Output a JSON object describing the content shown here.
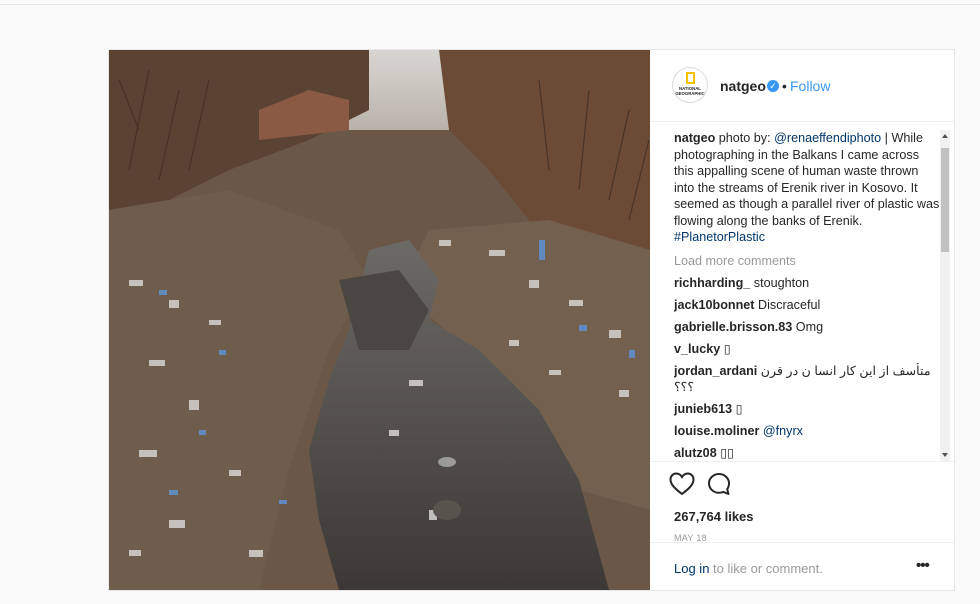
{
  "header": {
    "avatar_text": "NATIONAL GEOGRAPHIC",
    "username": "natgeo",
    "dot": "•",
    "follow_label": "Follow"
  },
  "caption": {
    "username": "natgeo",
    "text_before": " photo by: ",
    "mention": "@renaeffendiphoto",
    "text_after": " | While photographing in the Balkans I came across this appalling scene of human waste thrown into the streams of Erenik river in Kosovo. It seemed as though a parallel river of plastic was flowing along the banks of Erenik. ",
    "hashtag": "#PlanetorPlastic"
  },
  "load_more_label": "Load more comments",
  "comments": [
    {
      "user": "richharding_",
      "text": "stoughton"
    },
    {
      "user": "jack10bonnet",
      "text": "Discraceful"
    },
    {
      "user": "gabrielle.brisson.83",
      "text": "Omg"
    },
    {
      "user": "v_lucky",
      "text": "▯"
    },
    {
      "user": "jordan_ardani",
      "text": "متأسف از این کار انسا ن در قرن ؟؟؟"
    },
    {
      "user": "junieb613",
      "text": "▯"
    },
    {
      "user": "louise.moliner",
      "text": "@fnyrx"
    },
    {
      "user": "alutz08",
      "text": "▯▯"
    }
  ],
  "likes_label": "267,764 likes",
  "date_label": "MAY 18",
  "footer": {
    "login_link": "Log in",
    "login_text": " to like or comment.",
    "more_label": "•••"
  },
  "icons": {
    "verified": "verified-badge-icon",
    "like": "heart-icon",
    "comment": "comment-bubble-icon",
    "more": "more-options-icon"
  },
  "colors": {
    "link_blue": "#3897f0",
    "link_dark": "#003569",
    "muted": "#999999"
  }
}
